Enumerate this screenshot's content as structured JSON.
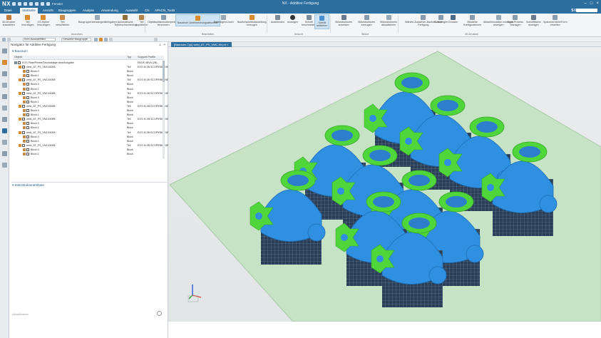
{
  "app": {
    "logo": "NX",
    "quick_access": "Fenster",
    "title": "NX - Additive Fertigung",
    "window_controls": [
      "–",
      "□",
      "×"
    ]
  },
  "menu": {
    "items": [
      "Datei",
      "Startseite",
      "Ansicht",
      "Baugruppen",
      "Analyse",
      "Anwendung",
      "Auswahl",
      "CN",
      "APACN_Tools"
    ],
    "active_index": 1,
    "brand": "SIEMENS"
  },
  "ribbon": {
    "buttons": [
      {
        "label": "3D-Drucker\nauswählen",
        "color": "#c07a3a"
      },
      {
        "label": "Teil\nhinzufügen",
        "color": "#d98b2f"
      },
      {
        "label": "CS-Stütze\nhinzufügen",
        "color": "#d98b2f"
      },
      {
        "label": "Teil\nverschieben",
        "color": "#c98a47"
      },
      {
        "label": "Baugruppeneinsatzgeräteingaben",
        "color": "#9aa9b6"
      },
      {
        "label": "Automatische\nTeilverschachtelung",
        "color": "#8f6d3f"
      },
      {
        "label": "Teil\nduplizieren",
        "color": "#b0854a"
      },
      {
        "label": "Objektkollisionsüberprüfung\nberechnen",
        "color": "#8a9bab"
      },
      {
        "label": "Baustrom-Unterbrechungsabschnitt",
        "color": "#d98b2f"
      },
      {
        "label": "Befestigen/Lösen",
        "color": "#9aa9b6"
      },
      {
        "label": "Baufortschrittsdarstellung\nerzeugen",
        "color": "#d98b2f"
      },
      {
        "label": "Ausblenden",
        "color": "#7d8b98"
      },
      {
        "label": "Anzeigen",
        "color": "#333333"
      },
      {
        "label": "Schnitt\nbeschneiden",
        "color": "#7d8b98"
      },
      {
        "label": "Schnitt\naktivieren",
        "color": "#4a8fcf"
      },
      {
        "label": "Stützstrukturen\nzuweisen",
        "color": "#6b7a8a"
      },
      {
        "label": "Stützstrukturen\nerzeugen",
        "color": "#8a9bab"
      },
      {
        "label": "Stützstrukturen\naktualisieren",
        "color": "#9aa9b6"
      },
      {
        "label": "Wählen-Aussehen-Baufortschritt\nFertigung",
        "color": "#8a9bab"
      },
      {
        "label": "G-Anzeigen",
        "color": "#8a9bab"
      },
      {
        "label": "Drucken",
        "color": "#4d6b86"
      },
      {
        "label": "Bündelte\nKonfigurationen",
        "color": "#8a9bab"
      },
      {
        "label": "Ablaufsimulation erzeugen\nanzeigen",
        "color": "#9aa9b6"
      },
      {
        "label": "Build Prozess\nManagen",
        "color": "#8a9bab"
      },
      {
        "label": "Schnittfläche\nanzeigen",
        "color": "#6b7a8a"
      },
      {
        "label": "Spannbereiche/Form\nerstellen",
        "color": "#8a9bab"
      }
    ],
    "groups": [
      "Anordnen",
      "Bearbeiten",
      "Ansicht",
      "Stütze",
      "3D-Drucken"
    ]
  },
  "subbar": {
    "filter": "Kein Auswahlfilter",
    "scope": "Gesamte Baugruppe"
  },
  "navigator": {
    "title": "Navigator für Additive Fertigung",
    "section_build": "Bauraum",
    "section_support": "Stützstrukturattribute",
    "columns": [
      "Objekt",
      "Typ",
      "Support Profile"
    ],
    "rows": [
      {
        "name": "EOS Plate/Printer/Druckablage:ohneAusgabe",
        "type": "",
        "support": "EBOS 4BVA (2B)...",
        "indent": 0,
        "kind": "printer"
      },
      {
        "name": "weld_AT_PS_VMC45008",
        "type": "Teil",
        "support": "EOS M 2B SCOPIRBIT NE",
        "indent": 1,
        "kind": "part"
      },
      {
        "name": "Block.0",
        "type": "Block",
        "support": "",
        "indent": 2,
        "kind": "block"
      },
      {
        "name": "Block.1",
        "type": "Block",
        "support": "",
        "indent": 2,
        "kind": "block"
      },
      {
        "name": "weld_AT_PS_VMC45008",
        "type": "Teil",
        "support": "EOS M 2B SCOPIRBIT NE",
        "indent": 1,
        "kind": "part"
      },
      {
        "name": "Block.0",
        "type": "Block",
        "support": "",
        "indent": 2,
        "kind": "block"
      },
      {
        "name": "Block.1",
        "type": "Block",
        "support": "",
        "indent": 2,
        "kind": "block"
      },
      {
        "name": "weld_AT_PS_VMC45008",
        "type": "Teil",
        "support": "EOS M 2B SCOPIRBIT NE",
        "indent": 1,
        "kind": "part"
      },
      {
        "name": "Block.0",
        "type": "Block",
        "support": "",
        "indent": 2,
        "kind": "block"
      },
      {
        "name": "Block.1",
        "type": "Block",
        "support": "",
        "indent": 2,
        "kind": "block"
      },
      {
        "name": "weld_AT_PS_VMC45008",
        "type": "Teil",
        "support": "EOS M 2B SCOPIRBIT NE",
        "indent": 1,
        "kind": "part"
      },
      {
        "name": "Block.0",
        "type": "Block",
        "support": "",
        "indent": 2,
        "kind": "block"
      },
      {
        "name": "Block.1",
        "type": "Block",
        "support": "",
        "indent": 2,
        "kind": "block"
      },
      {
        "name": "weld_AT_PS_VMC45008",
        "type": "Teil",
        "support": "EOS M 2B SCOPIRBIT NE",
        "indent": 1,
        "kind": "part"
      },
      {
        "name": "Block.0",
        "type": "Block",
        "support": "",
        "indent": 2,
        "kind": "block"
      },
      {
        "name": "Block.1",
        "type": "Block",
        "support": "",
        "indent": 2,
        "kind": "block"
      },
      {
        "name": "weld_AT_PS_VMC45008",
        "type": "Teil",
        "support": "EOS M 2B SCOPIRBIT NE",
        "indent": 1,
        "kind": "part"
      },
      {
        "name": "Block.0",
        "type": "Block",
        "support": "",
        "indent": 2,
        "kind": "block"
      },
      {
        "name": "Block.1",
        "type": "Block",
        "support": "",
        "indent": 2,
        "kind": "block"
      },
      {
        "name": "weld_AT_PS_VMC45008",
        "type": "Teil",
        "support": "EOS M 2B SCOPIRBIT NE",
        "indent": 1,
        "kind": "part"
      },
      {
        "name": "Block.0",
        "type": "Block",
        "support": "",
        "indent": 2,
        "kind": "block"
      },
      {
        "name": "Block.1",
        "type": "Block",
        "support": "",
        "indent": 2,
        "kind": "block"
      }
    ],
    "footer": "Aktualisieren"
  },
  "viewport": {
    "tab": "[Bauraum-Typ] weld_AT_PS_VMC-Kit.prt"
  },
  "colors": {
    "chrome": "#2c6e9e",
    "part_blue": "#2f8fe0",
    "flange_green": "#4fd63a",
    "support_dark": "#2a3f57",
    "build_plate": "#c6e3c6"
  }
}
